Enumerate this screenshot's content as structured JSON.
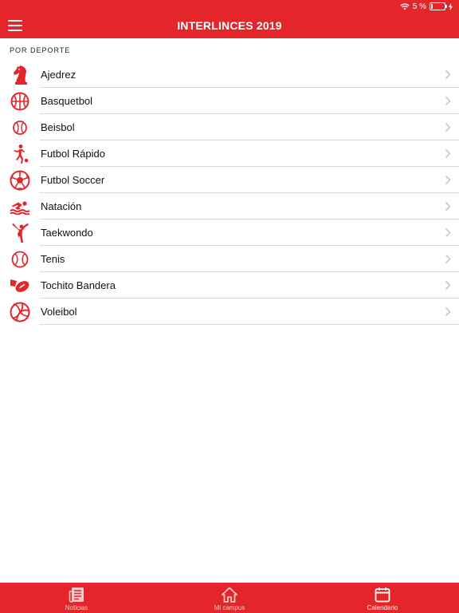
{
  "status": {
    "battery": "5 %"
  },
  "navbar": {
    "title": "INTERLINCES 2019"
  },
  "section": {
    "header": "POR DEPORTE"
  },
  "sports": [
    {
      "label": "Ajedrez",
      "icon": "chess-knight-icon"
    },
    {
      "label": "Basquetbol",
      "icon": "basketball-icon"
    },
    {
      "label": "Beisbol",
      "icon": "baseball-icon"
    },
    {
      "label": "Futbol Rápido",
      "icon": "soccer-player-icon"
    },
    {
      "label": "Futbol Soccer",
      "icon": "soccer-ball-icon"
    },
    {
      "label": "Natación",
      "icon": "swimmer-icon"
    },
    {
      "label": "Taekwondo",
      "icon": "martial-arts-icon"
    },
    {
      "label": "Tenis",
      "icon": "tennis-ball-icon"
    },
    {
      "label": "Tochito Bandera",
      "icon": "football-flag-icon"
    },
    {
      "label": "Voleibol",
      "icon": "volleyball-icon"
    }
  ],
  "tabs": [
    {
      "label": "Noticias",
      "icon": "newspaper-icon",
      "active": false
    },
    {
      "label": "Mi campus",
      "icon": "home-icon",
      "active": false
    },
    {
      "label": "Calendario",
      "icon": "calendar-icon",
      "active": true
    }
  ],
  "colors": {
    "brand": "#e4262a",
    "divider": "#d9d9d9",
    "chevron": "#c7c7cc"
  }
}
